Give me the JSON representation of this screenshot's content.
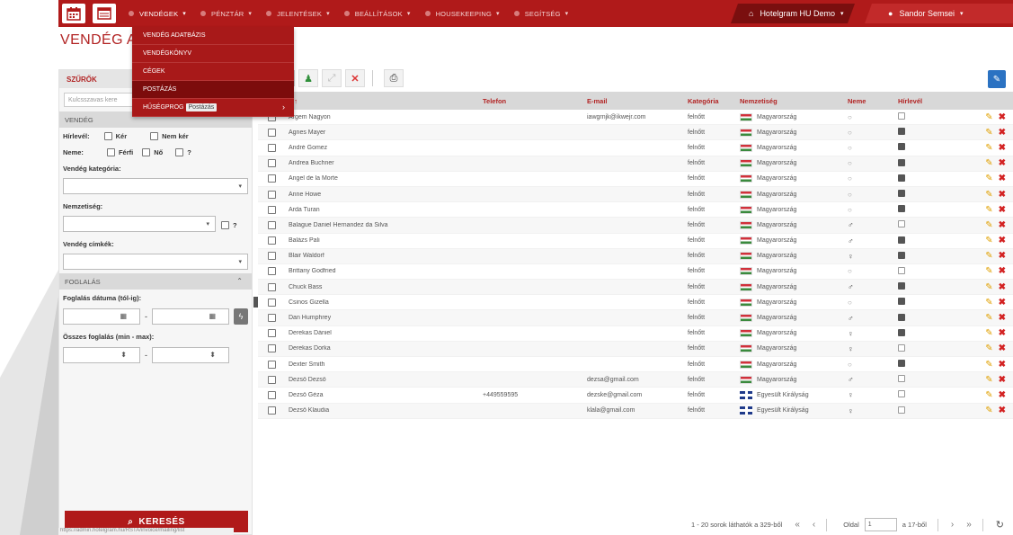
{
  "app": {
    "page_title": "VENDÉG AD",
    "hotel_selector": "Hotelgram HU Demo",
    "user_menu": "Sandor Semsei"
  },
  "topnav": {
    "items": [
      {
        "label": "VENDÉGEK",
        "active": true
      },
      {
        "label": "PÉNZTÁR",
        "active": false
      },
      {
        "label": "JELENTÉSEK",
        "active": false
      },
      {
        "label": "BEÁLLÍTÁSOK",
        "active": false
      },
      {
        "label": "HOUSEKEEPING",
        "active": false
      },
      {
        "label": "SEGÍTSÉG",
        "active": false
      }
    ]
  },
  "dropdown": {
    "items": [
      {
        "label": "VENDÉG ADATBÁZIS"
      },
      {
        "label": "VENDÉGKÖNYV"
      },
      {
        "label": "CÉGEK"
      },
      {
        "label": "POSTÁZÁS"
      },
      {
        "label": "HŰSÉGPROG"
      }
    ],
    "tooltip": "Postázás"
  },
  "filters": {
    "header": "SZŰRŐK",
    "search_placeholder": "Kulcsszavas kere",
    "vendeg_section": "VENDÉG",
    "hirlevel_label": "Hírlevél:",
    "hirlevel_options": [
      "Kér",
      "Nem kér"
    ],
    "neme_label": "Neme:",
    "neme_options": [
      "Férfi",
      "Nő",
      "?"
    ],
    "kategoria_label": "Vendég kategória:",
    "nemzetiseg_label": "Nemzetiség:",
    "nemzetiseg_unknown": "?",
    "cimkek_label": "Vendég címkék:",
    "foglalas_section": "FOGLALÁS",
    "datum_label": "Foglalás dátuma (tól-ig):",
    "osszes_label": "Összes foglalás (min - max):",
    "search_button": "KERESÉS",
    "status_url": "https://admin.hotelgram.hu/RSTA/invoice/mailing/list"
  },
  "table": {
    "headers": {
      "name": "v ↑",
      "phone": "Telefon",
      "email": "E-mail",
      "category": "Kategória",
      "nationality": "Nemzetiség",
      "gender": "Neme",
      "newsletter": "Hírlevél"
    },
    "rows": [
      {
        "name": "Argem Nagyon",
        "phone": "",
        "email": "iawgrnjk@ikwejr.com",
        "category": "felnőtt",
        "nationality": "Magyarország",
        "flag": "hu",
        "gender": "unknown",
        "newsletter": false
      },
      {
        "name": "Agnes Mayer",
        "phone": "",
        "email": "",
        "category": "felnőtt",
        "nationality": "Magyarország",
        "flag": "hu",
        "gender": "unknown",
        "newsletter": true
      },
      {
        "name": "André Gomez",
        "phone": "",
        "email": "",
        "category": "felnőtt",
        "nationality": "Magyarország",
        "flag": "hu",
        "gender": "unknown",
        "newsletter": true
      },
      {
        "name": "Andrea Buchner",
        "phone": "",
        "email": "",
        "category": "felnőtt",
        "nationality": "Magyarország",
        "flag": "hu",
        "gender": "unknown",
        "newsletter": true
      },
      {
        "name": "Angel de la Morte",
        "phone": "",
        "email": "",
        "category": "felnőtt",
        "nationality": "Magyarország",
        "flag": "hu",
        "gender": "unknown",
        "newsletter": true
      },
      {
        "name": "Anne Howe",
        "phone": "",
        "email": "",
        "category": "felnőtt",
        "nationality": "Magyarország",
        "flag": "hu",
        "gender": "unknown",
        "newsletter": true
      },
      {
        "name": "Arda Turan",
        "phone": "",
        "email": "",
        "category": "felnőtt",
        "nationality": "Magyarország",
        "flag": "hu",
        "gender": "unknown",
        "newsletter": true
      },
      {
        "name": "Balague Daniel Hernandez da Silva",
        "phone": "",
        "email": "",
        "category": "felnőtt",
        "nationality": "Magyarország",
        "flag": "hu",
        "gender": "male",
        "newsletter": false
      },
      {
        "name": "Balázs Pali",
        "phone": "",
        "email": "",
        "category": "felnőtt",
        "nationality": "Magyarország",
        "flag": "hu",
        "gender": "male",
        "newsletter": true
      },
      {
        "name": "Blair Waldorf",
        "phone": "",
        "email": "",
        "category": "felnőtt",
        "nationality": "Magyarország",
        "flag": "hu",
        "gender": "female",
        "newsletter": true
      },
      {
        "name": "Brittany Godfried",
        "phone": "",
        "email": "",
        "category": "felnőtt",
        "nationality": "Magyarország",
        "flag": "hu",
        "gender": "unknown",
        "newsletter": false
      },
      {
        "name": "Chuck Bass",
        "phone": "",
        "email": "",
        "category": "felnőtt",
        "nationality": "Magyarország",
        "flag": "hu",
        "gender": "male",
        "newsletter": true
      },
      {
        "name": "Csinos Gizella",
        "phone": "",
        "email": "",
        "category": "felnőtt",
        "nationality": "Magyarország",
        "flag": "hu",
        "gender": "unknown",
        "newsletter": true
      },
      {
        "name": "Dan Humphrey",
        "phone": "",
        "email": "",
        "category": "felnőtt",
        "nationality": "Magyarország",
        "flag": "hu",
        "gender": "male",
        "newsletter": true
      },
      {
        "name": "Derekas Dániel",
        "phone": "",
        "email": "",
        "category": "felnőtt",
        "nationality": "Magyarország",
        "flag": "hu",
        "gender": "female",
        "newsletter": true
      },
      {
        "name": "Derekas Dorka",
        "phone": "",
        "email": "",
        "category": "felnőtt",
        "nationality": "Magyarország",
        "flag": "hu",
        "gender": "female",
        "newsletter": false
      },
      {
        "name": "Dexter Smith",
        "phone": "",
        "email": "",
        "category": "felnőtt",
        "nationality": "Magyarország",
        "flag": "hu",
        "gender": "unknown",
        "newsletter": true
      },
      {
        "name": "Dezső Dezső",
        "phone": "",
        "email": "dezsa@gmail.com",
        "category": "felnőtt",
        "nationality": "Magyarország",
        "flag": "hu",
        "gender": "male",
        "newsletter": false
      },
      {
        "name": "Dezső Géza",
        "phone": "+449559595",
        "email": "dezske@gmail.com",
        "category": "felnőtt",
        "nationality": "Egyesült Királyság",
        "flag": "uk",
        "gender": "female",
        "newsletter": false
      },
      {
        "name": "Dezső Klaudia",
        "phone": "",
        "email": "klala@gmail.com",
        "category": "felnőtt",
        "nationality": "Egyesült Királyság",
        "flag": "uk",
        "gender": "female",
        "newsletter": false
      }
    ]
  },
  "pager": {
    "summary": "1 - 20 sorok láthatók a 329-ből",
    "page_label": "Oldal",
    "page_value": "1",
    "of_pages": "a 17-ből"
  },
  "icons": {
    "calendar": "calendar-icon",
    "list": "list-icon",
    "filter": "filter-icon",
    "add_user": "add-user-icon",
    "merge": "merge-icon",
    "delete": "delete-icon",
    "print": "print-icon",
    "wrench": "wrench-icon",
    "refresh": "refresh-icon"
  },
  "colors": {
    "brand_red": "#b01a1a",
    "dark_red": "#7a0f0f",
    "accent_blue": "#2b72c2"
  }
}
